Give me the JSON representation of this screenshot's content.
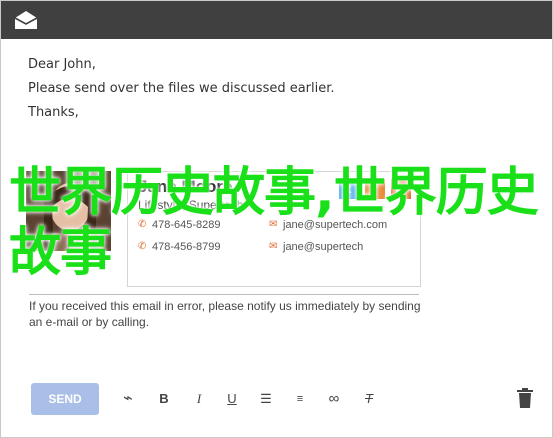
{
  "email": {
    "greeting": "Dear John,",
    "line1": "Please send over the files we discussed earlier.",
    "closing": "Thanks,"
  },
  "signature": {
    "name": "Jane Moore",
    "title": "Lifestyle, Supertech",
    "phone1": "478-645-8289",
    "phone2": "478-456-8799",
    "email1": "jane@supertech.com",
    "email2": "jane@supertech",
    "social_icons": [
      "twitter-icon",
      "facebook-icon",
      "linkedin-icon"
    ]
  },
  "disclaimer": "If you received this email in error, please notify us immediately by sending an e-mail or by calling.",
  "overlay_text": "世界历史故事,世界历史故事",
  "toolbar": {
    "send_label": "SEND",
    "tools": [
      "attach-icon",
      "bold-icon",
      "italic-icon",
      "underline-icon",
      "bulleted-list-icon",
      "numbered-list-icon",
      "link-icon",
      "clear-format-icon"
    ]
  },
  "colors": {
    "titlebar": "#404040",
    "send_button": "#a9bfe8",
    "overlay": "#1ae01a",
    "accent": "#e06b2d"
  }
}
